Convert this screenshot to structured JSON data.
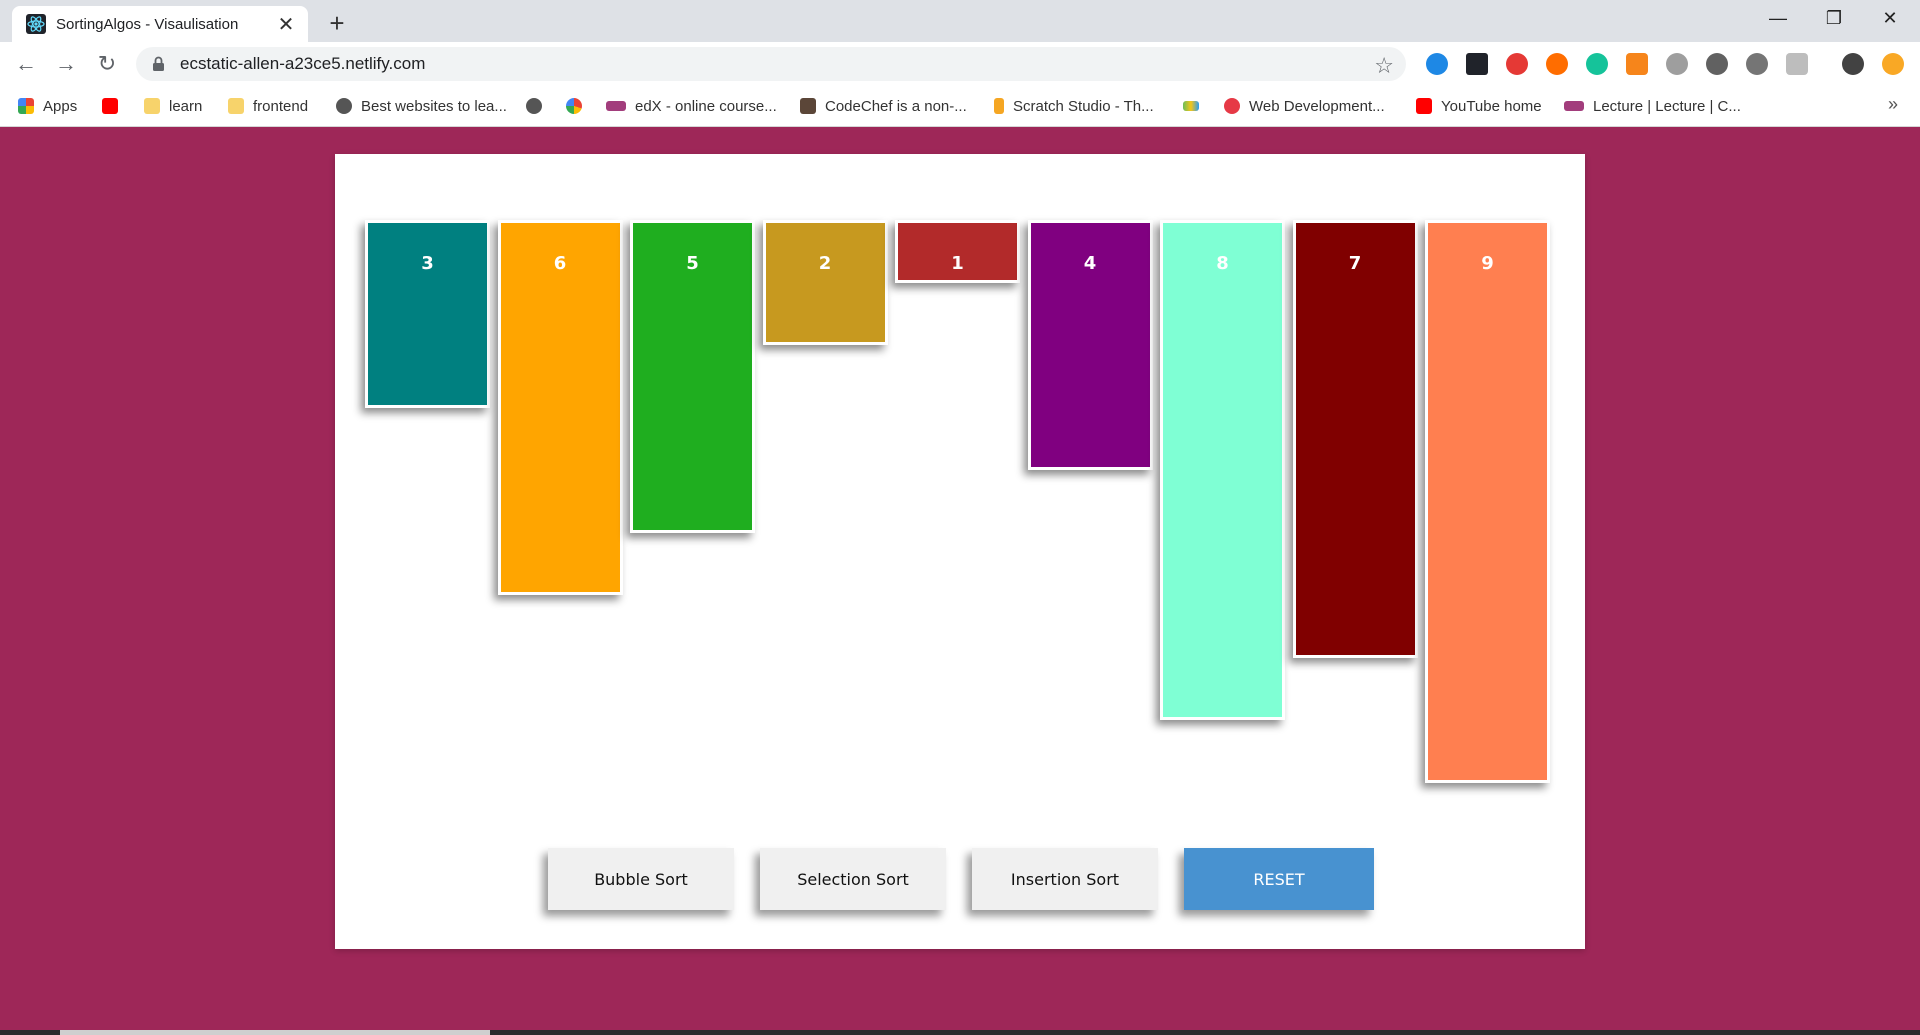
{
  "browser": {
    "tab": {
      "title": "SortingAlgos - Visaulisation",
      "close": "✕"
    },
    "new_tab": "+",
    "window_controls": {
      "minimize": "—",
      "restore": "❐",
      "close": "✕"
    },
    "url": "ecstatic-allen-a23ce5.netlify.com",
    "nav": {
      "back": "←",
      "forward": "→",
      "reload": "↻"
    },
    "star": "☆",
    "bookmarks": [
      {
        "label": "Apps",
        "icon": "apps-grid-icon",
        "color": "#4285f4"
      },
      {
        "label": "",
        "icon": "youtube-icon",
        "color": "#ff0000"
      },
      {
        "label": "learn",
        "icon": "folder-icon",
        "color": "#f7d36b"
      },
      {
        "label": "frontend",
        "icon": "folder-icon",
        "color": "#f7d36b"
      },
      {
        "label": "Best websites to lea...",
        "icon": "globe-icon",
        "color": "#555555"
      },
      {
        "label": "",
        "icon": "globe-icon",
        "color": "#555555"
      },
      {
        "label": "",
        "icon": "google-icon",
        "color": "#4285f4"
      },
      {
        "label": "edX - online course...",
        "icon": "edx-icon",
        "color": "#a23d7c"
      },
      {
        "label": "CodeChef is a non-...",
        "icon": "codechef-icon",
        "color": "#5b4638"
      },
      {
        "label": "Scratch Studio - Th...",
        "icon": "scratch-icon",
        "color": "#f5a623"
      },
      {
        "label": "",
        "icon": "stack-icon",
        "color": "#6bbf59"
      },
      {
        "label": "Web Development...",
        "icon": "r-icon",
        "color": "#e63946"
      },
      {
        "label": "YouTube home",
        "icon": "youtube-icon",
        "color": "#ff0000"
      },
      {
        "label": "Lecture | Lecture | C...",
        "icon": "edx-icon",
        "color": "#a23d7c"
      }
    ],
    "bookmarks_more": "»"
  },
  "chart_data": {
    "type": "bar",
    "categories": [
      "3",
      "6",
      "5",
      "2",
      "1",
      "4",
      "8",
      "7",
      "9"
    ],
    "values": [
      3,
      6,
      5,
      2,
      1,
      4,
      8,
      7,
      9
    ],
    "colors": [
      "#008080",
      "#ffa500",
      "#1fae1f",
      "#c7991f",
      "#b22a2a",
      "#800080",
      "#7fffd4",
      "#800000",
      "#ff7f50"
    ]
  },
  "controls": {
    "bubble": "Bubble Sort",
    "selection": "Selection Sort",
    "insertion": "Insertion Sort",
    "reset": "RESET"
  },
  "colors": {
    "page_background": "#9e2758",
    "reset_button": "#4892d0"
  }
}
